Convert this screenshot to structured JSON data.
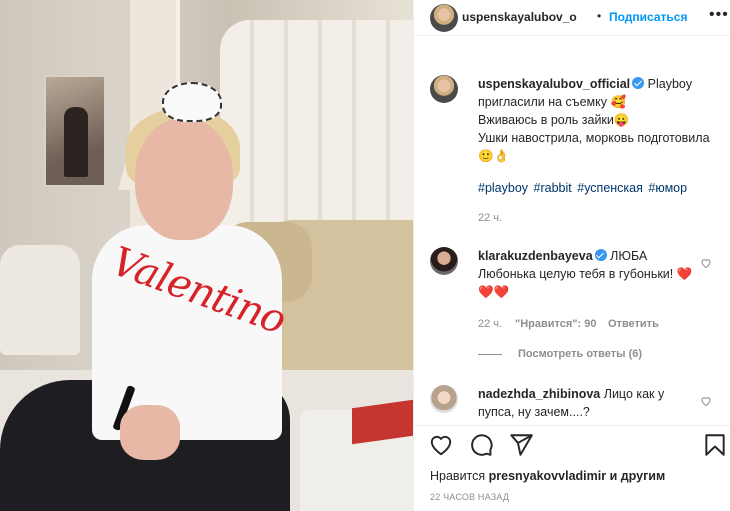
{
  "header": {
    "username": "uspenskayalubov_o",
    "separator": "•",
    "follow_label": "Подписаться",
    "more_label": "•••"
  },
  "photo": {
    "shirt_text": "Valentino"
  },
  "caption": {
    "username": "uspenskayalubov_official",
    "verified": true,
    "lines": [
      "Playboy пригласили на съемку 🥰",
      "Вживаюсь в роль зайки😛",
      "Ушки навострила, морковь подготовила 🙂👌"
    ],
    "hashtags": [
      "#playboy",
      "#rabbit",
      "#успенская",
      "#юмор"
    ],
    "time": "22 ч."
  },
  "comments": [
    {
      "username": "klarakuzdenbayeva",
      "verified": true,
      "text": "ЛЮБА Любонька целую тебя в губоньки! ❤️❤️❤️",
      "time": "22 ч.",
      "likes": "\"Нравится\": 90",
      "reply": "Ответить",
      "view_replies": "Посмотреть ответы (6)"
    },
    {
      "username": "nadezhda_zhibinova",
      "verified": false,
      "text": "Лицо как у пупса, ну зачем....?"
    }
  ],
  "footer": {
    "likes_prefix": "Нравится",
    "likes_user": "presnyakovvladimir",
    "likes_suffix": "и другим",
    "timestamp": "22 ЧАСОВ НАЗАД"
  },
  "icons": {
    "like": "heart-icon",
    "comment": "comment-icon",
    "share": "share-icon",
    "save": "bookmark-icon"
  },
  "colors": {
    "link_blue": "#0095f6",
    "hashtag": "#00376b",
    "muted": "#8e8e8e",
    "verified": "#3897f0"
  }
}
